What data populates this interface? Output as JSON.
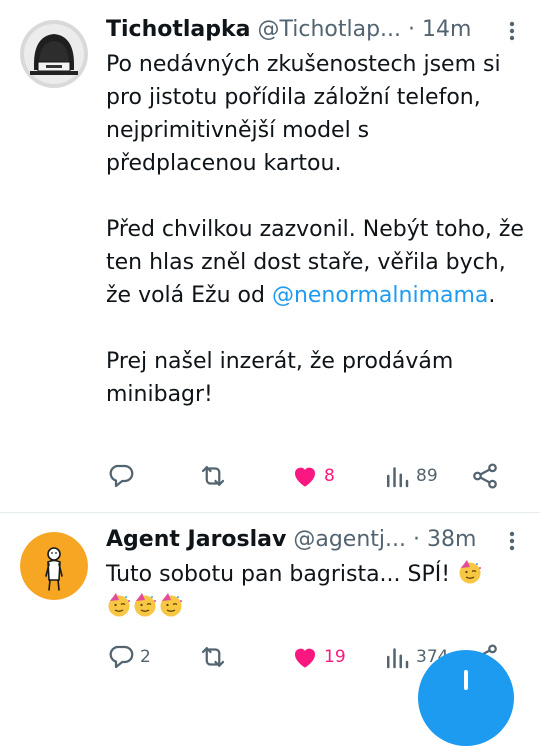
{
  "tweets": [
    {
      "author_name": "Tichotlapka",
      "handle": "@Tichotlap...",
      "separator": "·",
      "time": "14m",
      "paragraphs": {
        "p1": "Po nedávných zkušenostech jsem si pro jistotu pořídila záložní telefon, nejprimitivnější model s předplacenou kartou.",
        "p2_before": "Před chvilkou zazvonil. Nebýt toho, že ten hlas zněl dost staře, věřila bych, že volá Ežu od ",
        "p2_mention": "@nenormalnimama",
        "p2_after": ".",
        "p3": "Prej našel inzerát, že prodávám minibagr!"
      },
      "actions": {
        "replies": "",
        "retweets": "",
        "likes": "8",
        "views": "89"
      }
    },
    {
      "author_name": "Agent Jaroslav",
      "handle": "@agentj...",
      "separator": "·",
      "time": "38m",
      "text": "Tuto sobotu pan bagrista... SPÍ!",
      "actions": {
        "replies": "2",
        "retweets": "",
        "likes": "19",
        "views": "374"
      }
    }
  ],
  "icons": {
    "reply": "reply-icon",
    "retweet": "retweet-icon",
    "like": "heart-icon",
    "views": "views-icon",
    "share": "share-icon",
    "more": "more-icon",
    "compose": "plus-icon",
    "emoji": "party-face-emoji"
  },
  "colors": {
    "accent": "#1d9bf0",
    "like": "#f91880",
    "secondary": "#536471",
    "text": "#0f1419"
  }
}
